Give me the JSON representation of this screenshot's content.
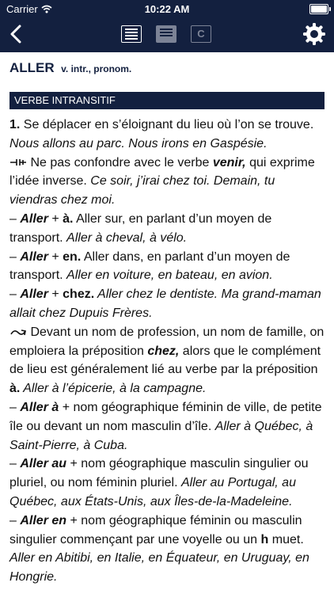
{
  "status_bar": {
    "carrier": "Carrier",
    "time": "10:22 AM",
    "battery_level": 1.0
  },
  "navbar": {
    "back_icon": "chevron-left-icon",
    "modes": [
      "lines-view-icon",
      "lines-view-dim-icon",
      "c-icon"
    ],
    "c_label": "C",
    "settings_icon": "gear-icon"
  },
  "entry": {
    "headword": "ALLER",
    "grammar": "v. intr., pronom.",
    "section": "VERBE INTRANSITIF",
    "sense1": {
      "num": "1.",
      "def": " Se déplacer en s’éloignant du lieu où l’on se trouve.",
      "ex": "Nous allons au parc. Nous irons en Gaspésie."
    },
    "note1": {
      "icon": "warning-hand-icon",
      "t1": " Ne pas confondre avec le verbe ",
      "b1": "venir,",
      "t2": " qui exprime l’idée inverse. ",
      "ex": "Ce soir, j’irai chez toi. Demain, tu viendras chez moi."
    },
    "item_a": {
      "dash": "– ",
      "kw": "Aller",
      "plus": " + ",
      "b": "à.",
      "def": " Aller sur, en parlant d’un moyen de transport. ",
      "ex": "Aller à cheval, à vélo."
    },
    "item_en": {
      "dash": "– ",
      "kw": "Aller",
      "plus": " + ",
      "b": "en.",
      "def": " Aller dans, en parlant d’un moyen de transport. ",
      "ex": "Aller en voiture, en bateau, en avion."
    },
    "item_chez": {
      "dash": "– ",
      "kw": "Aller",
      "plus": " + ",
      "b": "chez.",
      "ex": " Aller chez le dentiste. Ma grand-maman allait chez Dupuis Frères."
    },
    "note2": {
      "icon": "usage-note-icon",
      "t1": " Devant un nom de profession, un nom de famille, on emploiera la préposition ",
      "b1": "chez,",
      "t2": " alors que le complément de lieu est généralement lié au verbe par la préposition ",
      "b2": "à.",
      "ex": " Aller à l’épicerie, à la campagne."
    },
    "item_aller_a": {
      "dash": "– ",
      "kw": "Aller à",
      "text": " + nom géographique féminin de ville, de petite île ou devant un nom masculin d’île. ",
      "ex": "Aller à Québec, à Saint-Pierre, à Cuba."
    },
    "item_aller_au": {
      "dash": "– ",
      "kw": "Aller au",
      "text": " + nom géographique masculin singulier ou pluriel, ou nom féminin pluriel. ",
      "ex": "Aller au Portugal, au Québec, aux États-Unis, aux Îles-de-la-Madeleine."
    },
    "item_aller_en": {
      "dash": "– ",
      "kw": "Aller en",
      "text": " + nom géographique féminin ou masculin singulier commençant par une voyelle ou un ",
      "b": "h",
      "text2": " muet. ",
      "ex": "Aller en Abitibi, en Italie, en Équateur, en Uruguay, en Hongrie."
    }
  }
}
